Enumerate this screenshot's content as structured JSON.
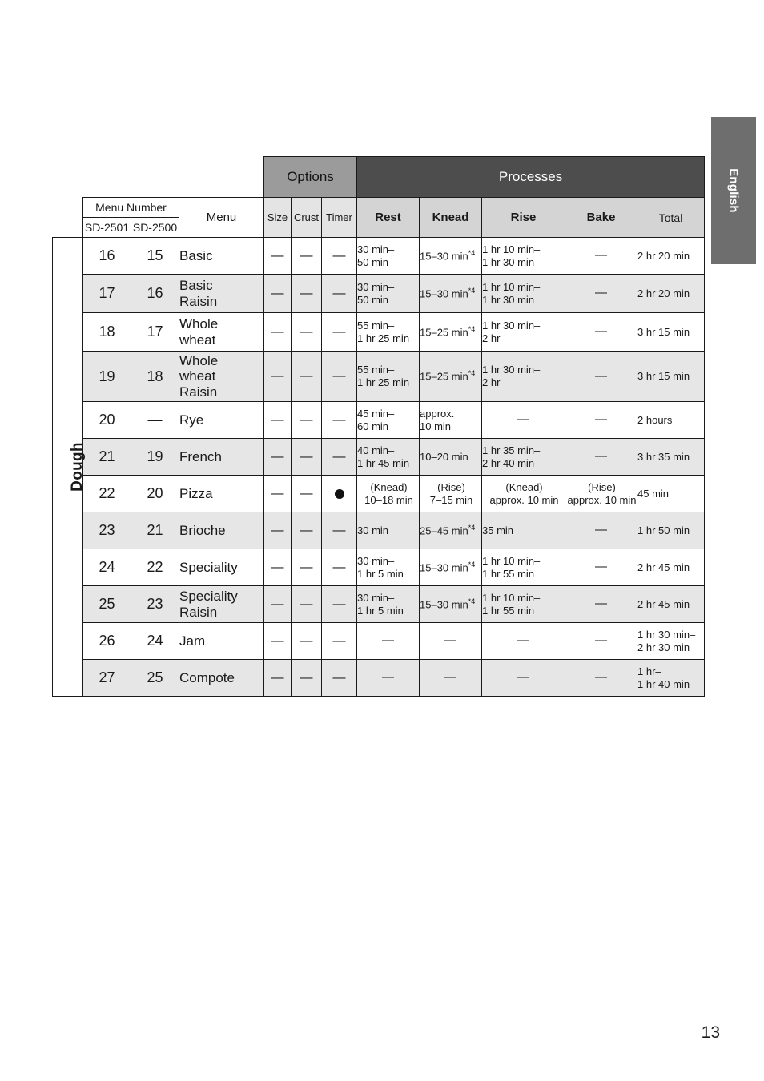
{
  "page": {
    "number": "13",
    "language_tab": "English"
  },
  "table": {
    "group_headers": {
      "options": "Options",
      "processes": "Processes"
    },
    "column_headers": {
      "menu_number": "Menu Number",
      "model_1": "SD-2501",
      "model_2": "SD-2500",
      "menu": "Menu",
      "size": "Size",
      "crust": "Crust",
      "timer": "Timer",
      "rest": "Rest",
      "knead": "Knead",
      "rise": "Rise",
      "bake": "Bake",
      "total": "Total"
    },
    "category_label": "Dough",
    "dash": "—",
    "rows": [
      {
        "no_2501": "16",
        "no_2500": "15",
        "menu_line1": "Basic",
        "menu_line2": "",
        "menu_line3": "",
        "size": "—",
        "crust": "—",
        "timer": "—",
        "timer_is_dot": false,
        "rest_l1": "30 min–",
        "rest_l2": "50 min",
        "knead_l1": "15–30 min",
        "knead_sup": "*4",
        "knead_l2": "",
        "rise_l1": "1 hr 10 min–",
        "rise_l2": "1 hr 30 min",
        "bake": "—",
        "total_l1": "2 hr 20 min",
        "total_l2": ""
      },
      {
        "no_2501": "17",
        "no_2500": "16",
        "menu_line1": "Basic",
        "menu_line2": "Raisin",
        "menu_line3": "",
        "size": "—",
        "crust": "—",
        "timer": "—",
        "timer_is_dot": false,
        "rest_l1": "30 min–",
        "rest_l2": "50 min",
        "knead_l1": "15–30 min",
        "knead_sup": "*4",
        "knead_l2": "",
        "rise_l1": "1 hr 10 min–",
        "rise_l2": "1 hr 30 min",
        "bake": "—",
        "total_l1": "2 hr 20 min",
        "total_l2": ""
      },
      {
        "no_2501": "18",
        "no_2500": "17",
        "menu_line1": "Whole",
        "menu_line2": "wheat",
        "menu_line3": "",
        "size": "—",
        "crust": "—",
        "timer": "—",
        "timer_is_dot": false,
        "rest_l1": "55 min–",
        "rest_l2": "1 hr 25 min",
        "knead_l1": "15–25 min",
        "knead_sup": "*4",
        "knead_l2": "",
        "rise_l1": "1 hr 30 min–",
        "rise_l2": "2 hr",
        "bake": "—",
        "total_l1": "3 hr 15 min",
        "total_l2": ""
      },
      {
        "no_2501": "19",
        "no_2500": "18",
        "menu_line1": "Whole",
        "menu_line2": "wheat",
        "menu_line3": "Raisin",
        "size": "—",
        "crust": "—",
        "timer": "—",
        "timer_is_dot": false,
        "rest_l1": "55 min–",
        "rest_l2": "1 hr 25 min",
        "knead_l1": "15–25 min",
        "knead_sup": "*4",
        "knead_l2": "",
        "rise_l1": "1 hr 30 min–",
        "rise_l2": "2 hr",
        "bake": "—",
        "total_l1": "3 hr 15 min",
        "total_l2": ""
      },
      {
        "no_2501": "20",
        "no_2500": "—",
        "menu_line1": "Rye",
        "menu_line2": "",
        "menu_line3": "",
        "size": "—",
        "crust": "—",
        "timer": "—",
        "timer_is_dot": false,
        "rest_l1": "45 min–",
        "rest_l2": "60 min",
        "knead_l1": "approx.",
        "knead_sup": "",
        "knead_l2": "10 min",
        "rise_l1": "—",
        "rise_l2": "",
        "bake": "—",
        "total_l1": "2 hours",
        "total_l2": ""
      },
      {
        "no_2501": "21",
        "no_2500": "19",
        "menu_line1": "French",
        "menu_line2": "",
        "menu_line3": "",
        "size": "—",
        "crust": "—",
        "timer": "—",
        "timer_is_dot": false,
        "rest_l1": "40 min–",
        "rest_l2": "1 hr 45 min",
        "knead_l1": "10–20 min",
        "knead_sup": "",
        "knead_l2": "",
        "rise_l1": "1 hr 35 min–",
        "rise_l2": "2 hr 40 min",
        "bake": "—",
        "total_l1": "3 hr 35 min",
        "total_l2": ""
      },
      {
        "no_2501": "22",
        "no_2500": "20",
        "menu_line1": "Pizza",
        "menu_line2": "",
        "menu_line3": "",
        "size": "—",
        "crust": "—",
        "timer": "●",
        "timer_is_dot": true,
        "rest_l1": "(Knead)",
        "rest_l2": "10–18 min",
        "knead_l1": "(Rise)",
        "knead_sup": "",
        "knead_l2": "7–15 min",
        "rise_l1": "(Knead)",
        "rise_l2": "approx. 10 min",
        "bake_l1": "(Rise)",
        "bake_l2": "approx. 10 min",
        "bake": "",
        "total_l1": "45 min",
        "total_l2": ""
      },
      {
        "no_2501": "23",
        "no_2500": "21",
        "menu_line1": "Brioche",
        "menu_line2": "",
        "menu_line3": "",
        "size": "—",
        "crust": "—",
        "timer": "—",
        "timer_is_dot": false,
        "rest_l1": "30 min",
        "rest_l2": "",
        "knead_l1": "25–45 min",
        "knead_sup": "*4",
        "knead_l2": "",
        "rise_l1": "35 min",
        "rise_l2": "",
        "bake": "—",
        "total_l1": "1 hr 50 min",
        "total_l2": ""
      },
      {
        "no_2501": "24",
        "no_2500": "22",
        "menu_line1": "Speciality",
        "menu_line2": "",
        "menu_line3": "",
        "size": "—",
        "crust": "—",
        "timer": "—",
        "timer_is_dot": false,
        "rest_l1": "30 min–",
        "rest_l2": "1 hr 5 min",
        "knead_l1": "15–30 min",
        "knead_sup": "*4",
        "knead_l2": "",
        "rise_l1": "1 hr 10 min–",
        "rise_l2": "1 hr 55 min",
        "bake": "—",
        "total_l1": "2 hr 45 min",
        "total_l2": ""
      },
      {
        "no_2501": "25",
        "no_2500": "23",
        "menu_line1": "Speciality",
        "menu_line2": "Raisin",
        "menu_line3": "",
        "size": "—",
        "crust": "—",
        "timer": "—",
        "timer_is_dot": false,
        "rest_l1": "30 min–",
        "rest_l2": "1 hr 5 min",
        "knead_l1": "15–30 min",
        "knead_sup": "*4",
        "knead_l2": "",
        "rise_l1": "1 hr 10 min–",
        "rise_l2": "1 hr 55 min",
        "bake": "—",
        "total_l1": "2 hr 45 min",
        "total_l2": ""
      },
      {
        "no_2501": "26",
        "no_2500": "24",
        "menu_line1": "Jam",
        "menu_line2": "",
        "menu_line3": "",
        "size": "—",
        "crust": "—",
        "timer": "—",
        "timer_is_dot": false,
        "rest_l1": "—",
        "rest_l2": "",
        "knead_l1": "—",
        "knead_sup": "",
        "knead_l2": "",
        "rise_l1": "—",
        "rise_l2": "",
        "bake": "—",
        "total_l1": "1 hr 30 min–",
        "total_l2": "2 hr 30 min"
      },
      {
        "no_2501": "27",
        "no_2500": "25",
        "menu_line1": "Compote",
        "menu_line2": "",
        "menu_line3": "",
        "size": "—",
        "crust": "—",
        "timer": "—",
        "timer_is_dot": false,
        "rest_l1": "—",
        "rest_l2": "",
        "knead_l1": "—",
        "knead_sup": "",
        "knead_l2": "",
        "rise_l1": "—",
        "rise_l2": "",
        "bake": "—",
        "total_l1": "1 hr–",
        "total_l2": "1 hr 40 min"
      }
    ]
  }
}
